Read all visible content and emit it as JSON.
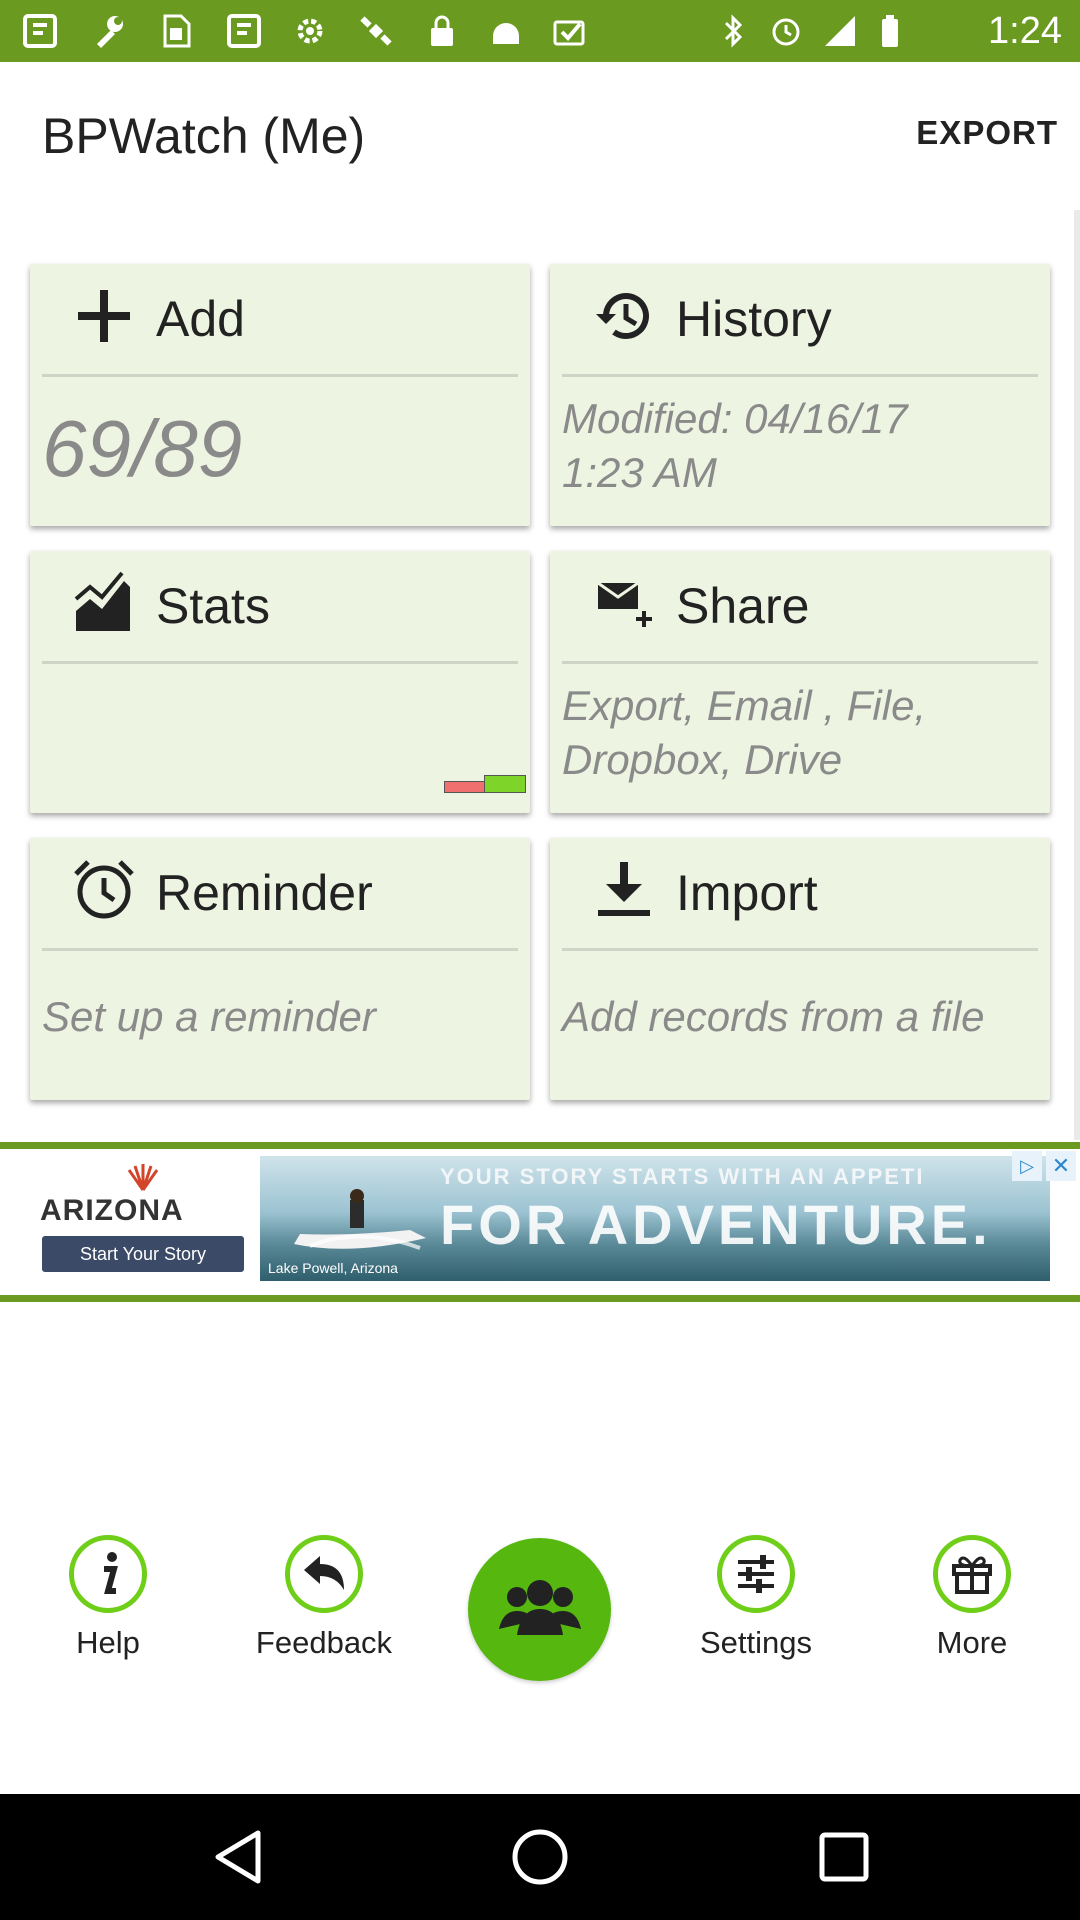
{
  "status_bar": {
    "time": "1:24",
    "left_icons": [
      "app-icon",
      "wrench-icon",
      "sim-icon",
      "app-icon",
      "settings-icon",
      "satellite-icon",
      "lock-icon",
      "android-icon",
      "image-check-icon"
    ],
    "right_icons": [
      "bluetooth-icon",
      "alarm-icon",
      "signal-icon",
      "battery-icon"
    ]
  },
  "app_bar": {
    "title": "BPWatch (Me)",
    "export_label": "EXPORT"
  },
  "cards": {
    "add": {
      "title": "Add",
      "value": "69/89"
    },
    "history": {
      "title": "History",
      "line1": "Modified: 04/16/17",
      "line2": "1:23 AM"
    },
    "stats": {
      "title": "Stats"
    },
    "share": {
      "title": "Share",
      "line1": "Export, Email , File,",
      "line2": "Dropbox, Drive"
    },
    "reminder": {
      "title": "Reminder",
      "body": "Set up a reminder"
    },
    "import": {
      "title": "Import",
      "body": "Add records from a file"
    }
  },
  "ad": {
    "brand": "ARIZONA",
    "cta": "Start Your Story",
    "tagline": "YOUR STORY STARTS WITH AN APPETI",
    "headline": "FOR ADVENTURE.",
    "credit": "Lake Powell, Arizona"
  },
  "bottom_nav": {
    "help": "Help",
    "feedback": "Feedback",
    "settings": "Settings",
    "more": "More"
  },
  "colors": {
    "accent": "#6a9a1f",
    "nav_green": "#6fcf18",
    "card_bg": "#eef4e2"
  }
}
